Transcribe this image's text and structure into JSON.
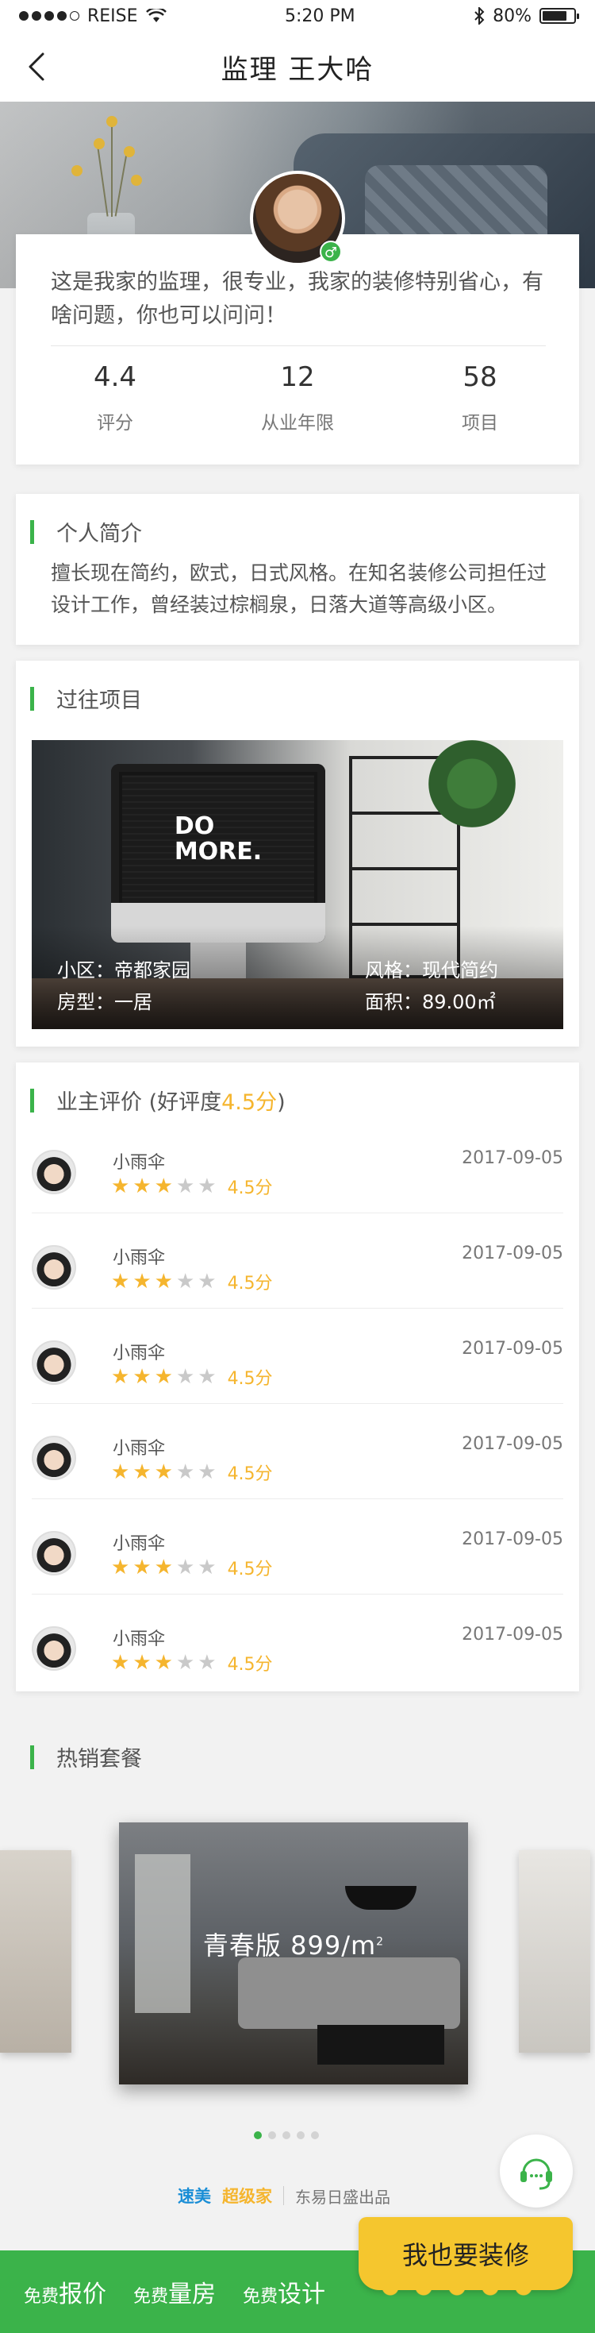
{
  "status_bar": {
    "carrier": "REISE",
    "time": "5:20 PM",
    "battery": "80%",
    "battery_level": 0.8
  },
  "nav": {
    "title": "监理  王大哈"
  },
  "profile": {
    "gender_symbol": "♂",
    "bio": "这是我家的监理，很专业，我家的装修特别省心，有啥问题，你也可以问问！",
    "stats": [
      {
        "value": "4.4",
        "label": "评分"
      },
      {
        "value": "12",
        "label": "从业年限"
      },
      {
        "value": "58",
        "label": "项目"
      }
    ]
  },
  "intro": {
    "title": "个人简介",
    "text": "擅长现在简约，欧式，日式风格。在知名装修公司担任过设计工作，曾经装过棕榈泉，日落大道等高级小区。"
  },
  "projects": {
    "title": "过往项目",
    "screen_text_line1": "DO",
    "screen_text_line2": "MORE.",
    "community": "小区：帝都家园",
    "room_type": "房型：一居",
    "style": "风格：现代简约",
    "area": "面积：89.00㎡"
  },
  "reviews": {
    "title_prefix": "业主评价 (好评度",
    "title_score": "4.5分",
    "title_suffix": ")",
    "items": [
      {
        "name": "小雨伞",
        "date": "2017-09-05",
        "score": "4.5分",
        "stars": 3
      },
      {
        "name": "小雨伞",
        "date": "2017-09-05",
        "score": "4.5分",
        "stars": 3
      },
      {
        "name": "小雨伞",
        "date": "2017-09-05",
        "score": "4.5分",
        "stars": 3
      },
      {
        "name": "小雨伞",
        "date": "2017-09-05",
        "score": "4.5分",
        "stars": 3
      },
      {
        "name": "小雨伞",
        "date": "2017-09-05",
        "score": "4.5分",
        "stars": 3
      },
      {
        "name": "小雨伞",
        "date": "2017-09-05",
        "score": "4.5分",
        "stars": 3
      }
    ]
  },
  "packages": {
    "title": "热销套餐",
    "main_label": "青春版",
    "main_price": "899",
    "main_unit": "/m",
    "main_unit_sup": "2",
    "dot_count": 5,
    "active_dot": 0
  },
  "brand": {
    "name_a": "速美",
    "name_b": "超级家",
    "producer": "东易日盛出品"
  },
  "bottom_bar": {
    "items": [
      {
        "prefix": "免费",
        "big": "报价"
      },
      {
        "prefix": "免费",
        "big": "量房"
      },
      {
        "prefix": "免费",
        "big": "设计"
      }
    ],
    "cta": "我也要装修"
  },
  "colors": {
    "accent_green": "#3bb34a",
    "star_gold": "#f5b52e",
    "cta_yellow": "#f5c62e"
  }
}
